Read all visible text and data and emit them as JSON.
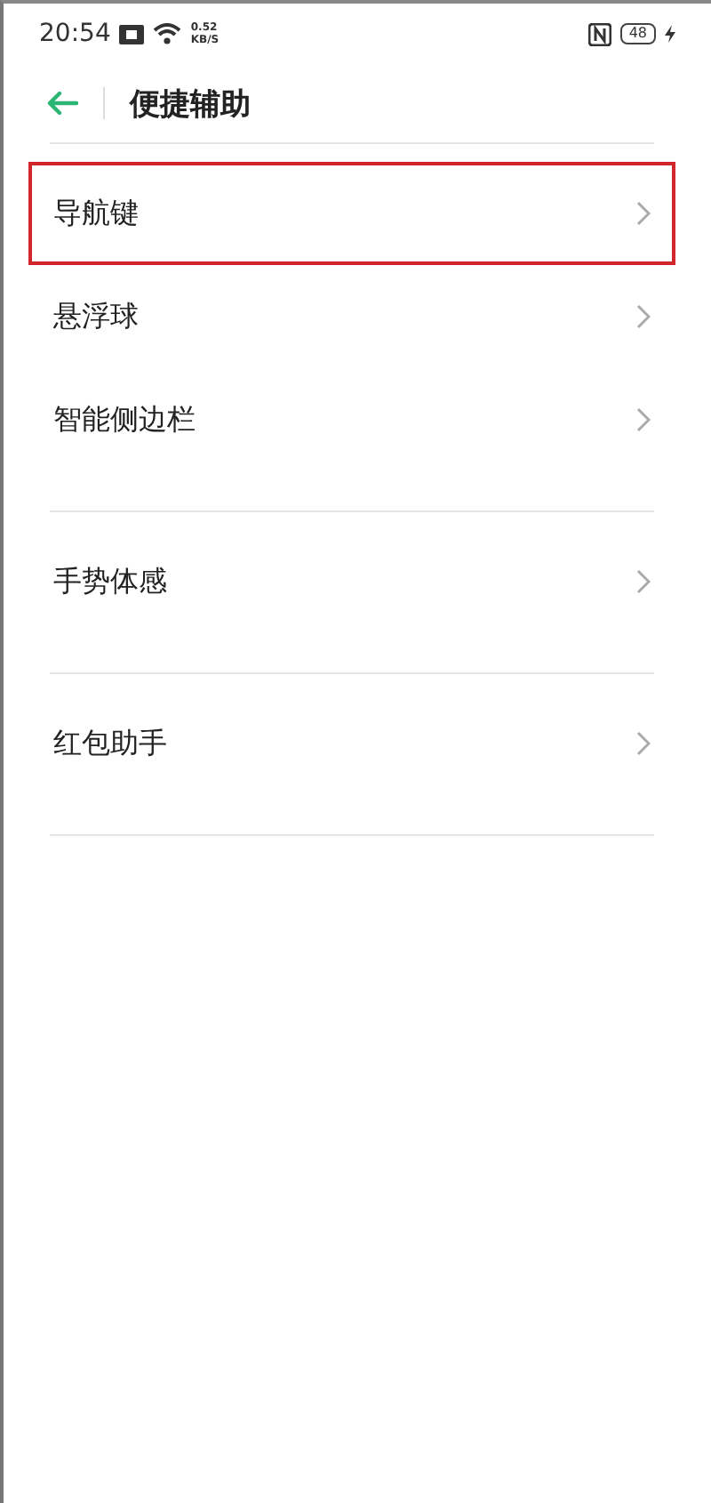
{
  "status_bar": {
    "time": "20:54",
    "speed": "0.52",
    "speed_unit": "KB/S",
    "battery": "48"
  },
  "header": {
    "title": "便捷辅助"
  },
  "groups": [
    {
      "items": [
        {
          "label": "导航键",
          "highlighted": true
        },
        {
          "label": "悬浮球",
          "highlighted": false
        },
        {
          "label": "智能侧边栏",
          "highlighted": false
        }
      ]
    },
    {
      "items": [
        {
          "label": "手势体感",
          "highlighted": false
        }
      ]
    },
    {
      "items": [
        {
          "label": "红包助手",
          "highlighted": false
        }
      ]
    }
  ]
}
